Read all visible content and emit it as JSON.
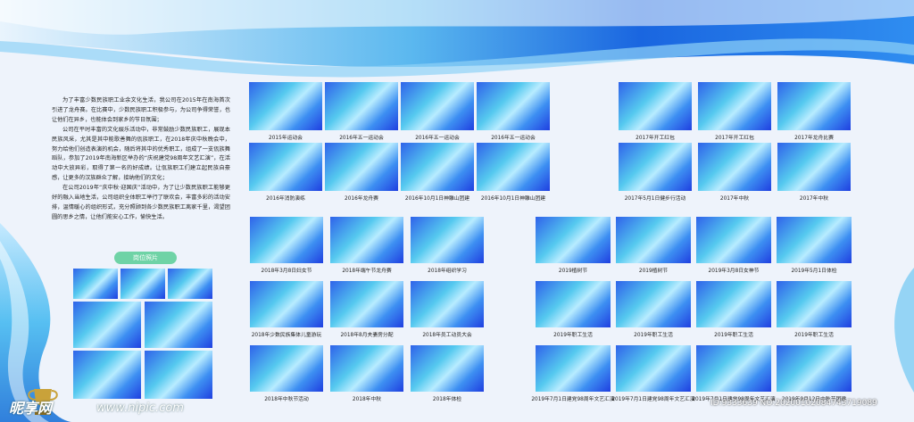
{
  "intro": {
    "paragraphs": [
      "为了丰富少数民族职工业余文化生活，我公司在2015年在南海首次引进了龙舟赛。在比赛中，少数民族职工积极参与，为公司争得荣誉，也让他们在异乡，也能体会到家乡的节日氛围；",
      "公司在平时丰富的文化娱乐活动中，非常鼓励少数民族职工，展现本民族风采，尤其是其中能歌善舞的佤族职工，在2018年庆中秋晚会中，努力给他们创造表演的机会，随后将其中的优秀职工，组成了一支佤族舞蹈队，参加了2019年南海新区举办的“庆祝建党98周年文艺汇演”，在活动中大放异彩，取得了第一名的好成绩。让佤族职工们建立起民族自豪感，让更多的汉族群众了解，接纳他们的文化；",
      "在公司2019年“庆中秋·迎国庆”活动中，为了让少数民族职工能够更好的融入当地生活，公司组织全体职工举行了联欢会，丰富多彩的活动安排，温情暖心的组织形式，充分照顾到各少数民族职工离家千里，渴望团圆的思乡之情，让他们能安心工作，愉快生活。"
    ]
  },
  "section_label": "岗位照片",
  "groups": [
    {
      "name": "group-2015-2016",
      "items": [
        {
          "caption": "2015年运动会"
        },
        {
          "caption": "2016年五一运动会"
        },
        {
          "caption": "2016年五一运动会"
        },
        {
          "caption": "2016年五一运动会"
        },
        {
          "caption": "2016年消防演练"
        },
        {
          "caption": "2016年龙舟赛"
        },
        {
          "caption": "2016年10月1日神雕山团建"
        },
        {
          "caption": "2016年10月1日神雕山团建"
        }
      ]
    },
    {
      "name": "group-2017",
      "items": [
        {
          "caption": "2017年开工红包"
        },
        {
          "caption": "2017年开工红包"
        },
        {
          "caption": "2017年龙舟比赛"
        },
        {
          "caption": "2017年5月1日健步行活动"
        },
        {
          "caption": "2017年中秋"
        },
        {
          "caption": "2017年中秋"
        }
      ]
    },
    {
      "name": "group-2018",
      "items": [
        {
          "caption": "2018年3月8日妇女节"
        },
        {
          "caption": "2018年端午节龙舟赛"
        },
        {
          "caption": "2018年组织学习"
        },
        {
          "caption": "2018年少数民族集体儿童游玩"
        },
        {
          "caption": "2018年8月夫妻房分配"
        },
        {
          "caption": "2018年员工动员大会"
        },
        {
          "caption": "2018年中秋节活动"
        },
        {
          "caption": "2018年中秋"
        },
        {
          "caption": "2018年体检"
        }
      ]
    },
    {
      "name": "group-2019",
      "items": [
        {
          "caption": "2019植树节"
        },
        {
          "caption": "2019植树节"
        },
        {
          "caption": "2019年3月8日女神节"
        },
        {
          "caption": "2019年5月1日体检"
        },
        {
          "caption": "2019年职工生活"
        },
        {
          "caption": "2019年职工生活"
        },
        {
          "caption": "2019年职工生活"
        },
        {
          "caption": "2019年职工生活"
        },
        {
          "caption": "2019年7月1日建党98周年文艺汇演"
        },
        {
          "caption": "2019年7月1日建党98周年文艺汇演"
        },
        {
          "caption": "2019年7月1日建党98周年文艺汇演"
        },
        {
          "caption": "2019年9月12日中秋节团建"
        }
      ]
    }
  ],
  "watermark": {
    "logo": "昵享网",
    "site": "www.nipic.com",
    "id": "ID:9333639 NO:20200102084743719089"
  },
  "colors": {
    "banner_blue": "#1a66e0",
    "label_green": "#6fd3a6"
  }
}
